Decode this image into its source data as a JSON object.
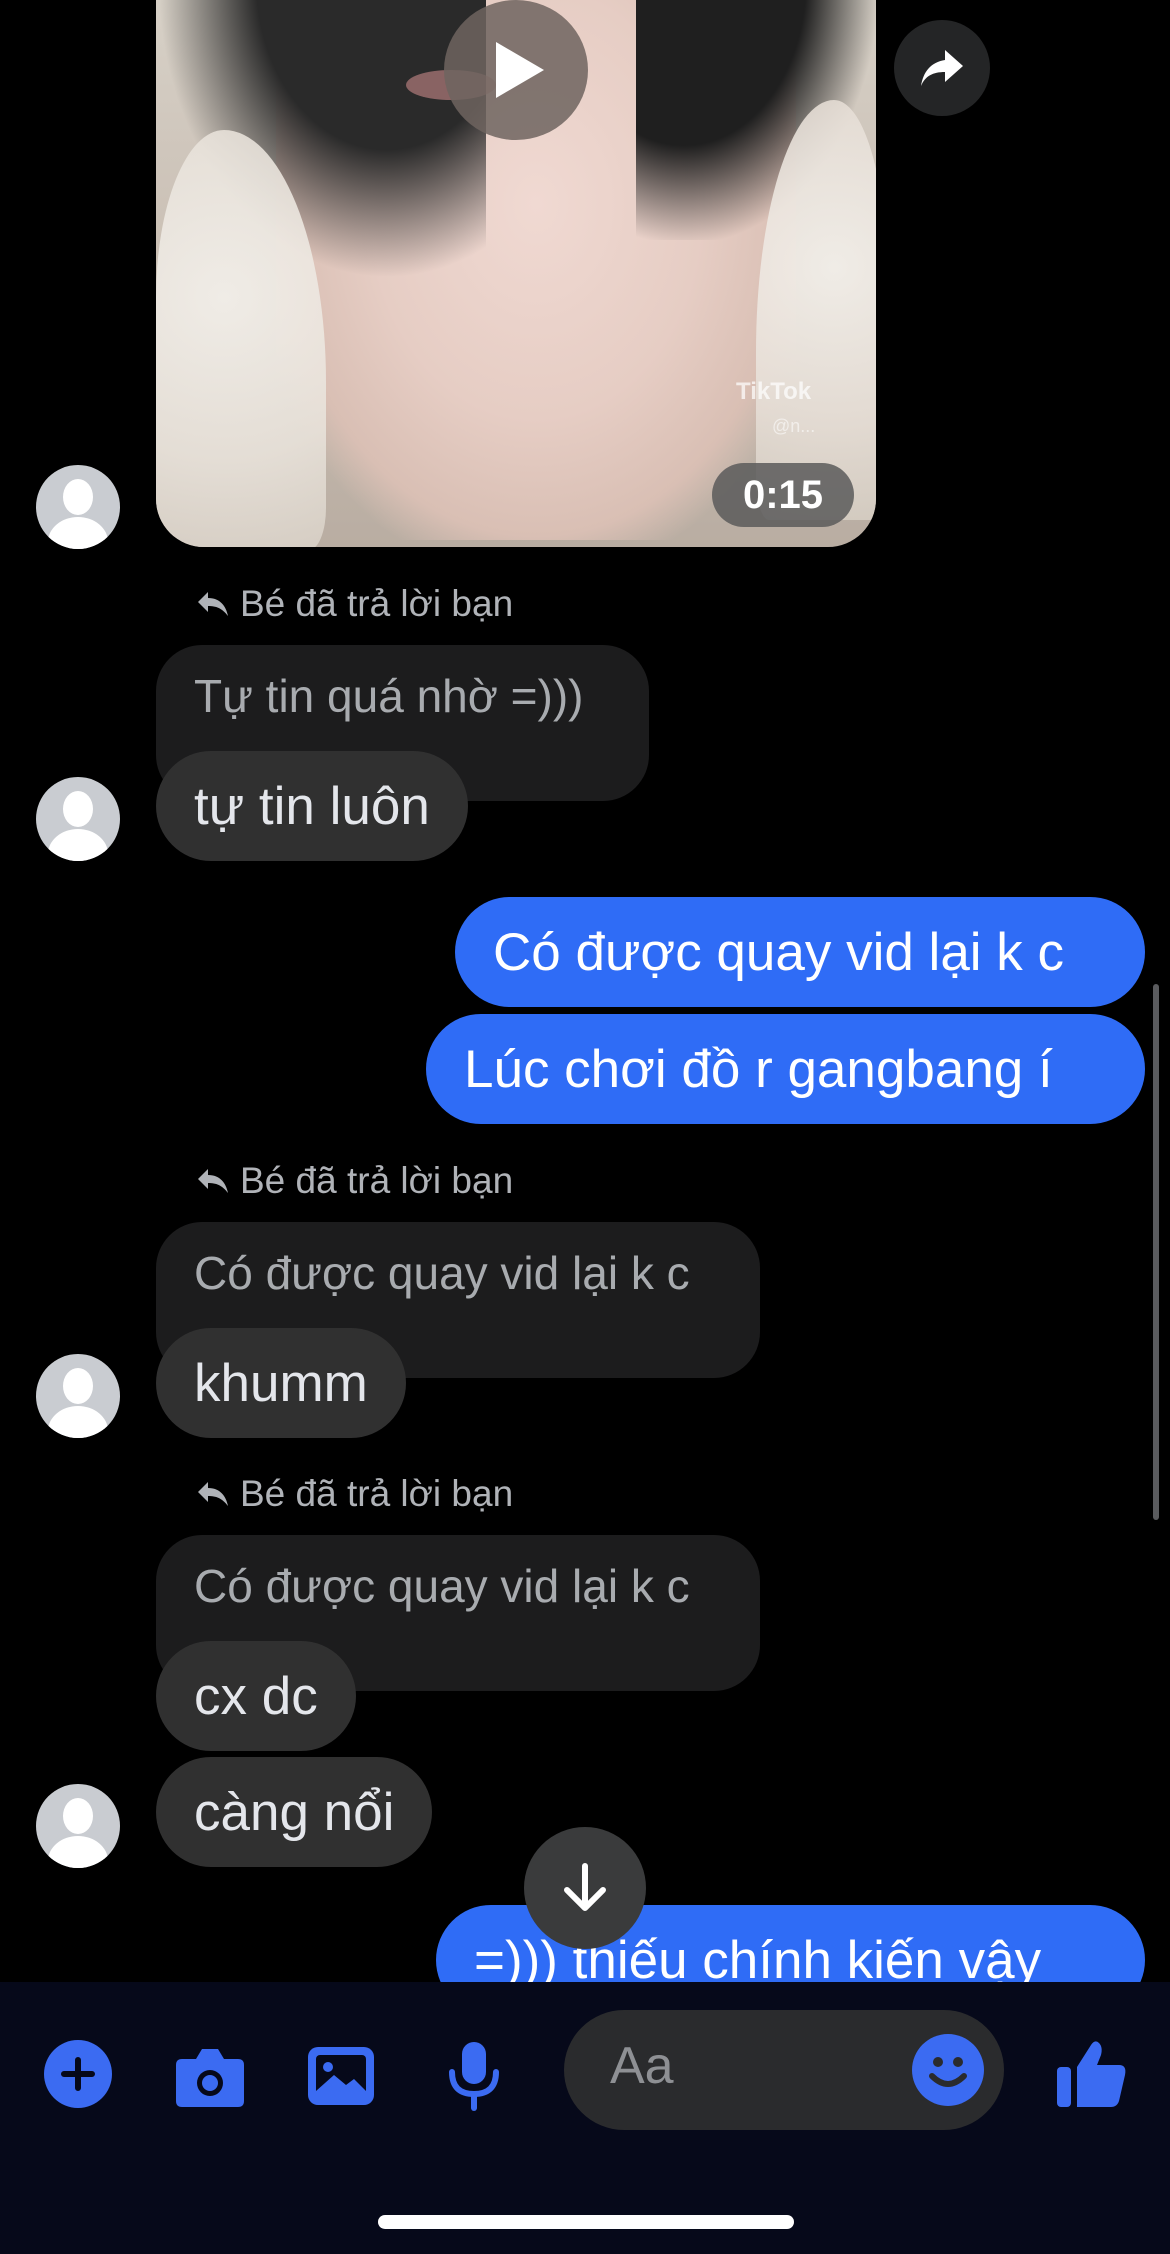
{
  "video": {
    "duration": "0:15",
    "watermark": "TikTok",
    "watermark_user": "@n..."
  },
  "messages": {
    "reply1": {
      "label": "Bé đã trả lời bạn",
      "quoted": "Tự tin quá nhờ =)))",
      "reply": "tự tin luôn"
    },
    "out1": "Có được quay vid lại k c",
    "out2": "Lúc chơi đồ r gangbang í",
    "reply2": {
      "label": "Bé đã trả lời bạn",
      "quoted": "Có được quay vid lại k c",
      "reply": "khumm"
    },
    "reply3": {
      "label": "Bé đã trả lời bạn",
      "quoted": "Có được quay vid lại k c",
      "reply": "cx dc",
      "followup": "càng nổi"
    },
    "out3": "=))) thiếu chính kiến vậy"
  },
  "composer": {
    "placeholder": "Aa"
  },
  "colors": {
    "accent": "#2f6cf6",
    "incoming_bubble": "#303030",
    "background": "#000000"
  },
  "icons": [
    "play-icon",
    "share-icon",
    "reply-arrow-icon",
    "scroll-down-icon",
    "plus-icon",
    "camera-icon",
    "gallery-icon",
    "microphone-icon",
    "emoji-icon",
    "thumbs-up-icon"
  ]
}
